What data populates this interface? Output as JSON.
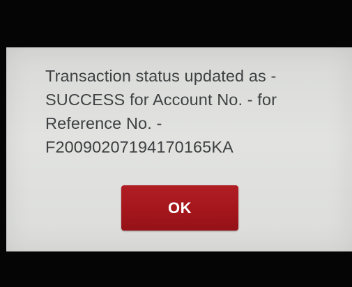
{
  "dialog": {
    "message_lines": [
      "Transaction status updated as -",
      "SUCCESS for Account No. - for",
      "Reference No. -",
      "F20090207194170165KA"
    ],
    "ok_label": "OK"
  },
  "colors": {
    "screen_background": "#000000",
    "dialog_background": "#dfe0de",
    "message_text": "#3f4042",
    "button_background": "#a4161c",
    "button_text": "#ffffff"
  }
}
